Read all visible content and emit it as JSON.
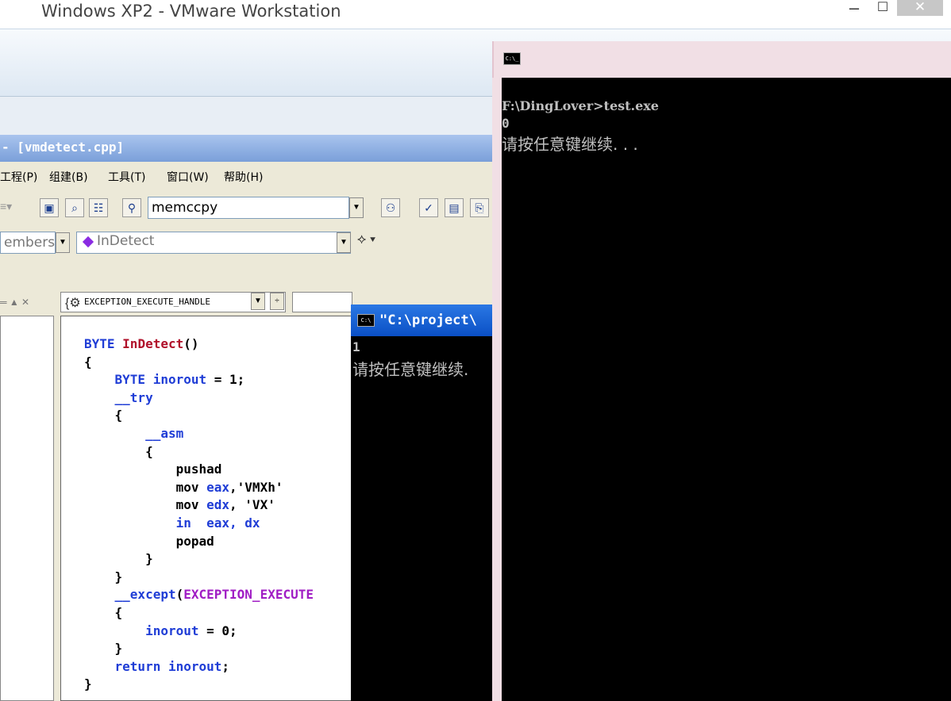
{
  "host": {
    "title": "Windows XP2 - VMware Workstation",
    "min_glyph": "–",
    "max_glyph": "☐",
    "close_glyph": "✕"
  },
  "ide": {
    "title": "- [vmdetect.cpp]",
    "menu": [
      "工程(P)",
      "组建(B)",
      "工具(T)",
      "窗口(W)",
      "帮助(H)"
    ],
    "find_combo": "memccpy",
    "class_combo": "embers",
    "member_combo": "InDetect",
    "wizard_combo": "EXCEPTION_EXECUTE_HANDLE",
    "code_lines": [
      [
        {
          "t": "BYTE ",
          "c": "kw"
        },
        {
          "t": "InDetect",
          "c": "fn"
        },
        {
          "t": "()",
          "c": "pl"
        }
      ],
      [
        {
          "t": "{",
          "c": "pl"
        }
      ],
      [
        {
          "t": "    BYTE inorout",
          "c": "kw"
        },
        {
          "t": " = 1;",
          "c": "pl"
        }
      ],
      [
        {
          "t": "    __try",
          "c": "kw"
        }
      ],
      [
        {
          "t": "    {",
          "c": "pl"
        }
      ],
      [
        {
          "t": "        __asm",
          "c": "kw"
        }
      ],
      [
        {
          "t": "        {",
          "c": "pl"
        }
      ],
      [
        {
          "t": "            pushad",
          "c": "pl"
        }
      ],
      [
        {
          "t": "            mov ",
          "c": "pl"
        },
        {
          "t": "eax",
          "c": "kw"
        },
        {
          "t": ",'VMXh'",
          "c": "pl"
        }
      ],
      [
        {
          "t": "            mov ",
          "c": "pl"
        },
        {
          "t": "edx",
          "c": "kw"
        },
        {
          "t": ", 'VX'",
          "c": "pl"
        }
      ],
      [
        {
          "t": "            in  eax, dx",
          "c": "kw"
        }
      ],
      [
        {
          "t": "            popad",
          "c": "pl"
        }
      ],
      [
        {
          "t": "        }",
          "c": "pl"
        }
      ],
      [
        {
          "t": "    }",
          "c": "pl"
        }
      ],
      [
        {
          "t": "    __except",
          "c": "kw"
        },
        {
          "t": "(",
          "c": "pl"
        },
        {
          "t": "EXCEPTION_EXECUTE",
          "c": "mac"
        }
      ],
      [
        {
          "t": "    {",
          "c": "pl"
        }
      ],
      [
        {
          "t": "        inorout",
          "c": "kw"
        },
        {
          "t": " = 0;",
          "c": "pl"
        }
      ],
      [
        {
          "t": "    }",
          "c": "pl"
        }
      ],
      [
        {
          "t": "    return inorout",
          "c": "kw"
        },
        {
          "t": ";",
          "c": "pl"
        }
      ],
      [
        {
          "t": "}",
          "c": "pl"
        }
      ]
    ]
  },
  "console_small": {
    "title": "\"C:\\project\\",
    "lines": [
      "1",
      "请按任意键继续."
    ]
  },
  "console_big": {
    "icon_label": "C:\\_",
    "lines": [
      "F:\\DingLover>test.exe",
      "0",
      "请按任意键继续. . ."
    ]
  }
}
